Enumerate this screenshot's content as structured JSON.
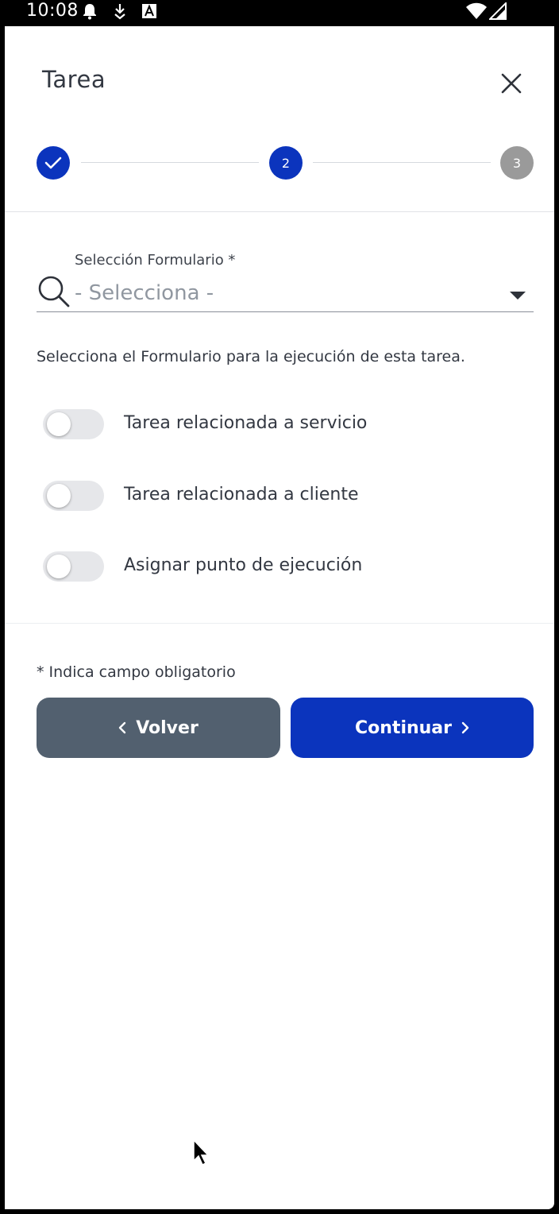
{
  "status_bar": {
    "time": "10:08",
    "icons": [
      "bell-icon",
      "download-icon",
      "a-box-icon",
      "wifi-icon",
      "signal-icon"
    ]
  },
  "dialog": {
    "title": "Tarea",
    "close_icon": "close-icon"
  },
  "stepper": {
    "steps": [
      {
        "label": "",
        "state": "completed",
        "icon": "check-icon"
      },
      {
        "label": "2",
        "state": "active"
      },
      {
        "label": "3",
        "state": "pending"
      }
    ],
    "colors": {
      "active": "#0b34bd",
      "pending": "#9a9a9a"
    }
  },
  "form": {
    "field_label": "Selección Formulario *",
    "select_value": "- Selecciona -",
    "helper_text": "Selecciona el Formulario para la ejecución de esta tarea.",
    "toggles": [
      {
        "label": "Tarea relacionada a servicio",
        "on": false
      },
      {
        "label": "Tarea relacionada a cliente",
        "on": false
      },
      {
        "label": "Asignar punto de ejecución",
        "on": false
      }
    ]
  },
  "footer": {
    "required_note": "* Indica campo obligatorio",
    "back_label": "Volver",
    "next_label": "Continuar",
    "colors": {
      "back": "#52606f",
      "next": "#0b34bd"
    }
  }
}
